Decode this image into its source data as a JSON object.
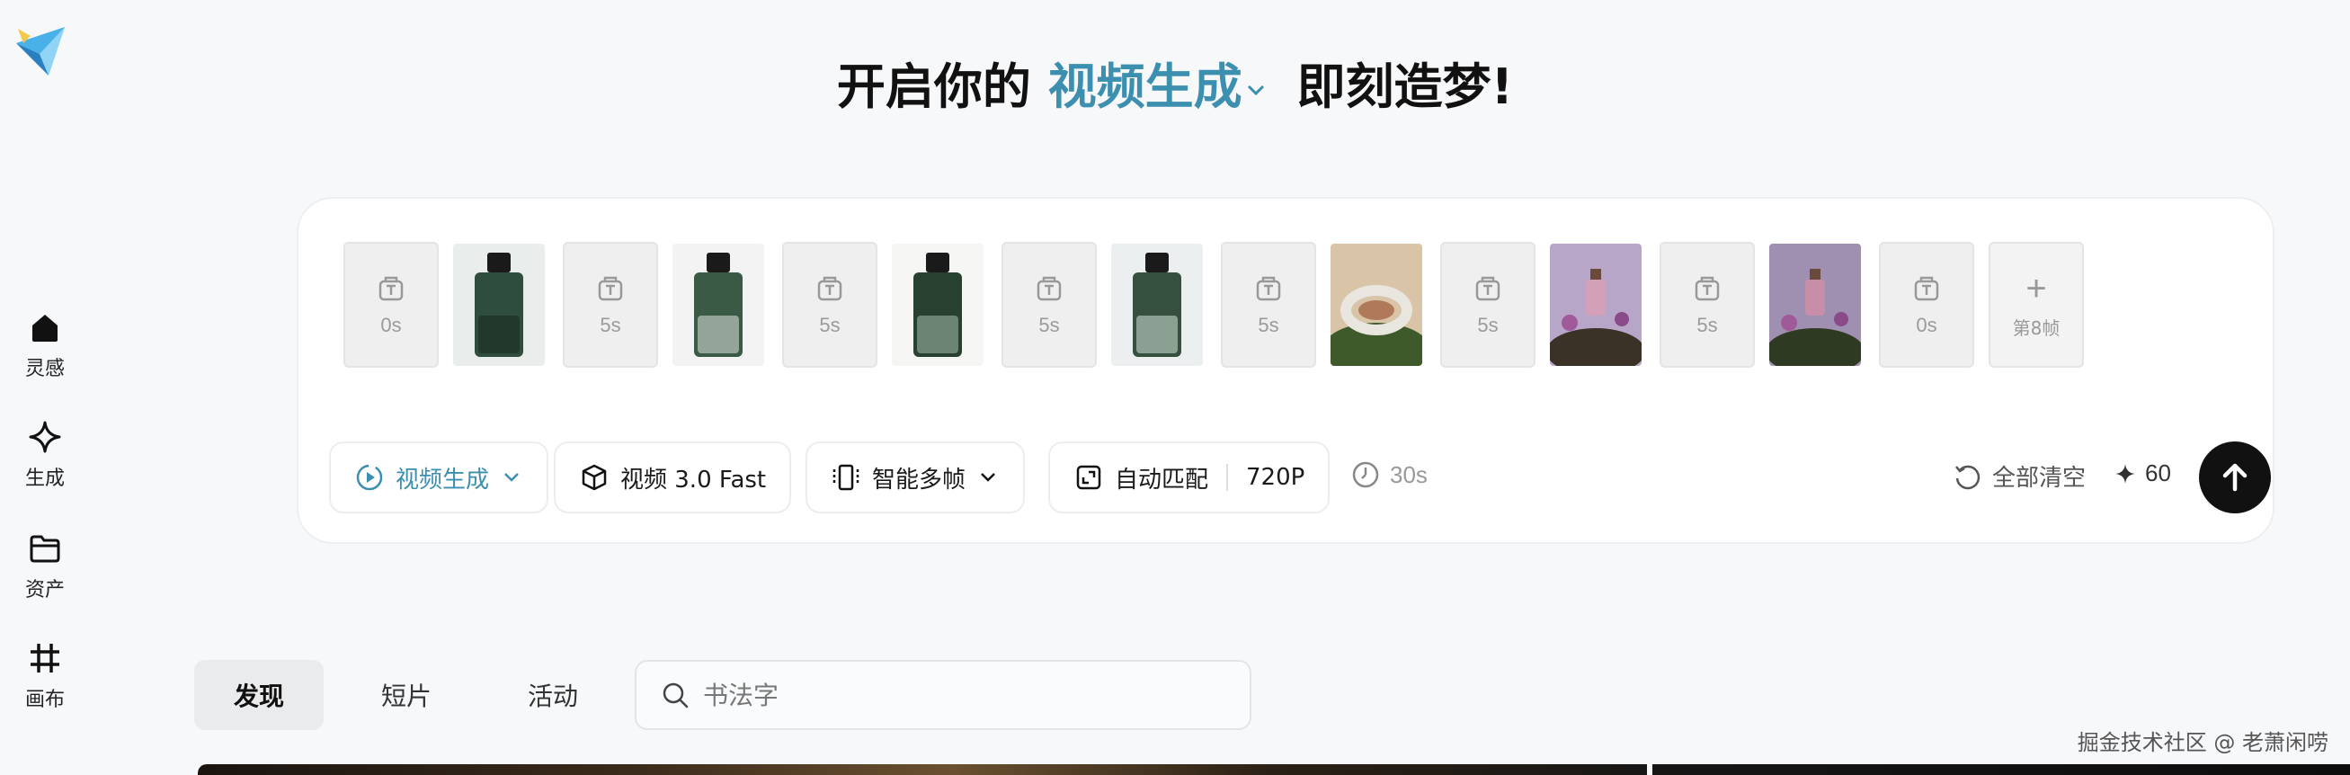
{
  "sidebar": {
    "logo_icon": "paper-plane-logo",
    "items": [
      {
        "label": "灵感",
        "icon": "home-icon"
      },
      {
        "label": "生成",
        "icon": "sparkle-icon"
      },
      {
        "label": "资产",
        "icon": "folder-icon"
      },
      {
        "label": "画布",
        "icon": "canvas-grid-icon"
      }
    ]
  },
  "headline": {
    "prefix": "开启你的",
    "mode": "视频生成",
    "suffix": "即刻造梦!"
  },
  "composer": {
    "frames": [
      {
        "type": "slot",
        "duration": "0s"
      },
      {
        "type": "image",
        "subject": "green perfume bottle"
      },
      {
        "type": "slot",
        "duration": "5s"
      },
      {
        "type": "image",
        "subject": "small perfume bottle on white"
      },
      {
        "type": "slot",
        "duration": "5s"
      },
      {
        "type": "image",
        "subject": "green perfume bottle with label"
      },
      {
        "type": "slot",
        "duration": "5s"
      },
      {
        "type": "image",
        "subject": "gradient green perfume bottle"
      },
      {
        "type": "slot",
        "duration": "5s"
      },
      {
        "type": "image",
        "subject": "jade bracelet on moss"
      },
      {
        "type": "slot",
        "duration": "5s"
      },
      {
        "type": "image",
        "subject": "pink perfume with flowers"
      },
      {
        "type": "slot",
        "duration": "5s"
      },
      {
        "type": "image",
        "subject": "pink perfume with moss"
      },
      {
        "type": "slot",
        "duration": "0s"
      }
    ],
    "add_frame_label": "第8帧",
    "toolbar": {
      "mode_label": "视频生成",
      "model_label": "视频 3.0 Fast",
      "frames_mode_label": "智能多帧",
      "ratio_label": "自动匹配",
      "resolution_label": "720P",
      "duration_label": "30s",
      "clear_label": "全部清空",
      "credits": "60"
    }
  },
  "tabs": [
    {
      "label": "发现",
      "active": true
    },
    {
      "label": "短片",
      "active": false
    },
    {
      "label": "活动",
      "active": false
    }
  ],
  "search": {
    "placeholder": "书法字",
    "value": ""
  },
  "watermark": "掘金技术社区 @ 老萧闲唠",
  "colors": {
    "accent": "#3d8fb0",
    "send_button": "#111111",
    "background": "#f7f8fa"
  }
}
